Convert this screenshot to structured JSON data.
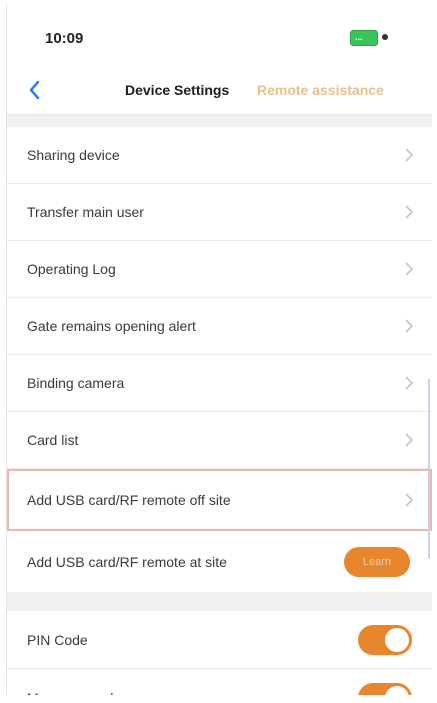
{
  "status_bar": {
    "time": "10:09",
    "battery": "..."
  },
  "nav": {
    "title": "Device Settings",
    "right_label": "Remote assistance"
  },
  "settings_rows": [
    {
      "label": "Sharing device"
    },
    {
      "label": "Transfer main user"
    },
    {
      "label": "Operating Log"
    },
    {
      "label": "Gate remains opening alert"
    },
    {
      "label": "Binding camera"
    },
    {
      "label": "Card list"
    },
    {
      "label": "Add USB card/RF remote off site"
    }
  ],
  "usb_at_site": {
    "label": "Add USB card/RF remote at site",
    "button_label": "Learn"
  },
  "toggles": [
    {
      "label": "PIN Code",
      "on": true
    },
    {
      "label": "Message push",
      "on": true
    }
  ],
  "colors": {
    "accent": "#e8862e",
    "nav_right": "#e9c089",
    "battery": "#39c35b"
  },
  "icons": {
    "back": "chevron-left-icon",
    "row": "chevron-right-icon"
  }
}
